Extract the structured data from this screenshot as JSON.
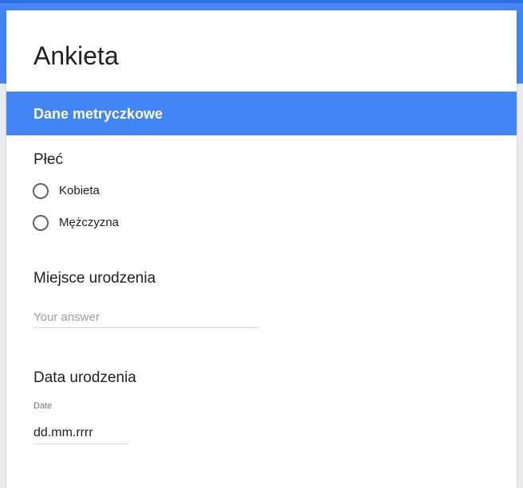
{
  "form": {
    "title": "Ankieta"
  },
  "section": {
    "title": "Dane metryczkowe"
  },
  "questions": {
    "gender": {
      "title": "Płeć",
      "options": [
        {
          "label": "Kobieta",
          "selected": false
        },
        {
          "label": "Mężczyzna",
          "selected": false
        }
      ]
    },
    "birthplace": {
      "title": "Miejsce urodzenia",
      "value": "",
      "placeholder": "Your answer"
    },
    "birthdate": {
      "title": "Data urodzenia",
      "caption": "Date",
      "value": "",
      "placeholder": "dd.mm.rrrr"
    }
  },
  "colors": {
    "accent": "#4285f4",
    "background": "#e8eaf0",
    "card": "#ffffff"
  }
}
